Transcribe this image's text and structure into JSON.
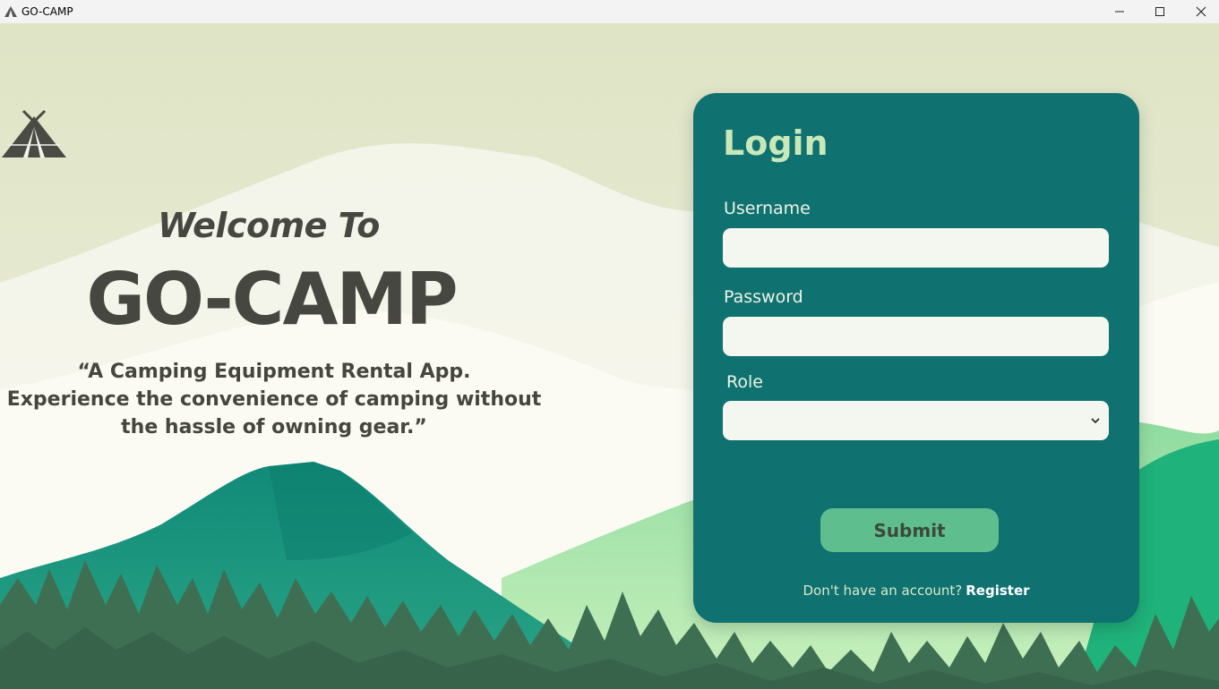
{
  "window": {
    "title": "GO-CAMP",
    "controls": [
      "minimize-icon",
      "maximize-icon",
      "close-icon"
    ]
  },
  "hero": {
    "welcome": "Welcome To",
    "brand": "GO-CAMP",
    "tagline": [
      "“A Camping Equipment Rental App.",
      "Experience the convenience of camping without",
      "the hassle of owning gear.”"
    ]
  },
  "login": {
    "title": "Login",
    "username_label": "Username",
    "username_value": "",
    "password_label": "Password",
    "password_value": "",
    "role_label": "Role",
    "role_selected": "",
    "submit_label": "Submit",
    "register_prompt": "Don't have an account?",
    "register_link": "Register"
  },
  "colors": {
    "card": "#0f7170",
    "title_accent": "#c9e8b9",
    "submit": "#5fbe8e",
    "heading_text": "#464740",
    "forest": "#3f6f53",
    "mountain": "#1c8f7c"
  }
}
